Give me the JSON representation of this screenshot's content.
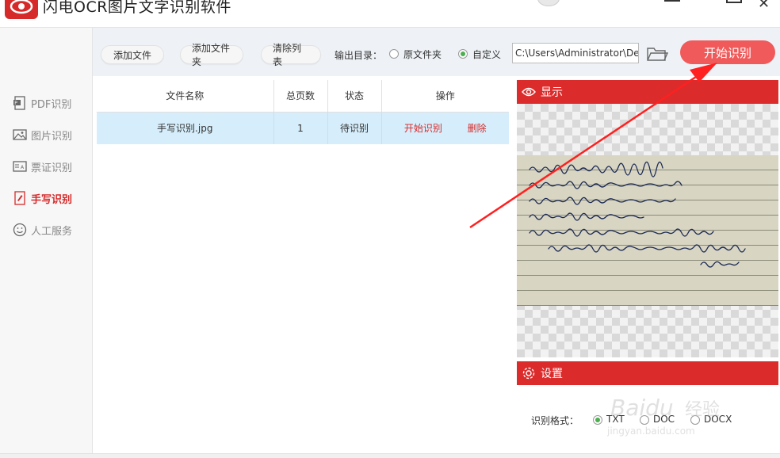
{
  "app": {
    "title": "闪电OCR图片文字识别软件"
  },
  "sidebar": {
    "items": [
      {
        "label": "PDF识别",
        "icon": "pdf-icon",
        "active": false
      },
      {
        "label": "图片识别",
        "icon": "image-icon",
        "active": false
      },
      {
        "label": "票证识别",
        "icon": "ticket-icon",
        "active": false
      },
      {
        "label": "手写识别",
        "icon": "handwriting-icon",
        "active": true
      },
      {
        "label": "人工服务",
        "icon": "smiley-icon",
        "active": false
      }
    ]
  },
  "toolbar": {
    "add_file": "添加文件",
    "add_folder": "添加文件夹",
    "clear_list": "清除列表",
    "output_label": "输出目录：",
    "radio_original": "原文件夹",
    "radio_custom": "自定义",
    "selected_output": "自定义",
    "path_value": "C:\\Users\\Administrator\\De",
    "start_button": "开始识别"
  },
  "table": {
    "headers": [
      "文件名称",
      "总页数",
      "状态",
      "操作"
    ],
    "rows": [
      {
        "name": "手写识别.jpg",
        "pages": "1",
        "status": "待识别",
        "action_start": "开始识别",
        "action_delete": "删除"
      }
    ]
  },
  "preview": {
    "title": "显示"
  },
  "settings": {
    "title": "设置",
    "format_label": "识别格式：",
    "formats": [
      "TXT",
      "DOC",
      "DOCX"
    ],
    "selected_format": "TXT"
  },
  "watermark": {
    "text": "Baidu经验",
    "sub": "jingyan.baidu.com"
  },
  "colors": {
    "accent": "#dc2b2b",
    "start_button": "#f05a5a",
    "row_highlight": "#d6eefb",
    "toolbar_bg": "#eef2f6"
  }
}
